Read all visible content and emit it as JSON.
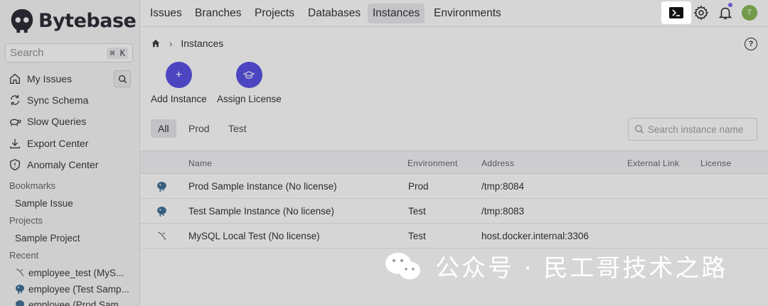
{
  "brand": {
    "name": "Bytebase"
  },
  "sidebar": {
    "search": {
      "placeholder": "Search",
      "shortcut": "⌘ K"
    },
    "nav": [
      {
        "label": "My Issues",
        "icon": "home-icon"
      },
      {
        "label": "Sync Schema",
        "icon": "sync-icon"
      },
      {
        "label": "Slow Queries",
        "icon": "turtle-icon"
      },
      {
        "label": "Export Center",
        "icon": "download-icon"
      },
      {
        "label": "Anomaly Center",
        "icon": "shield-icon"
      }
    ],
    "bookmarks_label": "Bookmarks",
    "bookmarks": [
      "Sample Issue"
    ],
    "projects_label": "Projects",
    "projects": [
      "Sample Project"
    ],
    "recent_label": "Recent",
    "recent": [
      {
        "label": "employee_test (MyS...",
        "icon": "mysql-icon"
      },
      {
        "label": "employee (Test Samp...",
        "icon": "postgres-icon"
      },
      {
        "label": "employee (Prod Sam...",
        "icon": "postgres-icon"
      }
    ]
  },
  "topnav": {
    "tabs": [
      "Issues",
      "Branches",
      "Projects",
      "Databases",
      "Instances",
      "Environments"
    ],
    "active": "Instances",
    "avatar_initial": "T"
  },
  "breadcrumb": {
    "current": "Instances"
  },
  "actions": [
    {
      "label": "Add Instance",
      "icon": "plus-icon"
    },
    {
      "label": "Assign License",
      "icon": "graduation-cap-icon"
    }
  ],
  "filters": [
    "All",
    "Prod",
    "Test"
  ],
  "search_instance": {
    "placeholder": "Search instance name"
  },
  "table": {
    "columns": [
      "Name",
      "Environment",
      "Address",
      "External Link",
      "License"
    ],
    "rows": [
      {
        "name": "Prod Sample Instance (No license)",
        "environment": "Prod",
        "address": "/tmp:8084",
        "icon": "postgres-icon"
      },
      {
        "name": "Test Sample Instance (No license)",
        "environment": "Test",
        "address": "/tmp:8083",
        "icon": "postgres-icon"
      },
      {
        "name": "MySQL Local Test (No license)",
        "environment": "Test",
        "address": "host.docker.internal:3306",
        "icon": "mysql-icon"
      }
    ]
  },
  "watermark": {
    "text": "公众号 · 民工哥技术之路"
  },
  "colors": {
    "accent": "#4f46e5",
    "avatar": "#7fb34a",
    "notify_dot": "#6b5ef0"
  }
}
